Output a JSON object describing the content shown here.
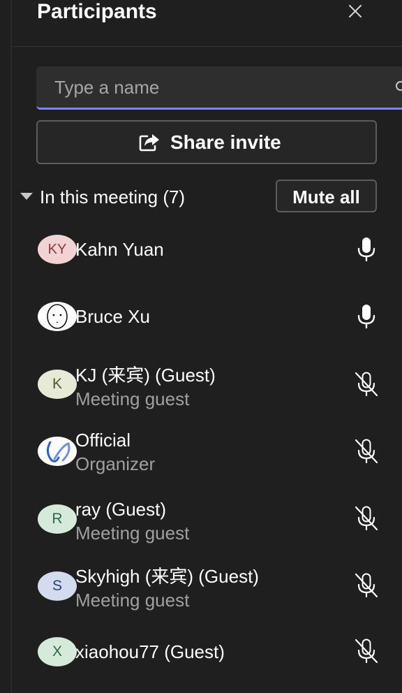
{
  "panel": {
    "title": "Participants"
  },
  "search": {
    "placeholder": "Type a name"
  },
  "share": {
    "label": "Share invite"
  },
  "section": {
    "label": "In this meeting (7)",
    "mute_all_label": "Mute all"
  },
  "colors": {
    "accent": "#7f85f5",
    "background": "#1f1f1f"
  },
  "participants": [
    {
      "name": "Kahn Yuan",
      "role": "",
      "initials": "KY",
      "avatar_bg": "#f1d3d3",
      "avatar_fg": "#8a3b3b",
      "mic": "mic-on-icon"
    },
    {
      "name": "Bruce Xu",
      "role": "",
      "initials": "",
      "avatar_bg": "#ffffff",
      "avatar_fg": "#000000",
      "mic": "mic-on-icon"
    },
    {
      "name": "KJ (来宾) (Guest)",
      "role": "Meeting guest",
      "initials": "K",
      "avatar_bg": "#e7ead7",
      "avatar_fg": "#4a5a2a",
      "mic": "mic-off-icon"
    },
    {
      "name": "Official",
      "role": "Organizer",
      "initials": "",
      "avatar_bg": "#ffffff",
      "avatar_fg": "#2e5fd8",
      "mic": "mic-off-icon"
    },
    {
      "name": "ray (Guest)",
      "role": "Meeting guest",
      "initials": "R",
      "avatar_bg": "#d5eadb",
      "avatar_fg": "#2f6b3e",
      "mic": "mic-off-icon"
    },
    {
      "name": "Skyhigh (来宾) (Guest)",
      "role": "Meeting guest",
      "initials": "S",
      "avatar_bg": "#d3dbef",
      "avatar_fg": "#2d3f75",
      "mic": "mic-off-icon"
    },
    {
      "name": "xiaohou77 (Guest)",
      "role": "",
      "initials": "X",
      "avatar_bg": "#d5eadb",
      "avatar_fg": "#2f6b3e",
      "mic": "mic-off-icon"
    }
  ]
}
